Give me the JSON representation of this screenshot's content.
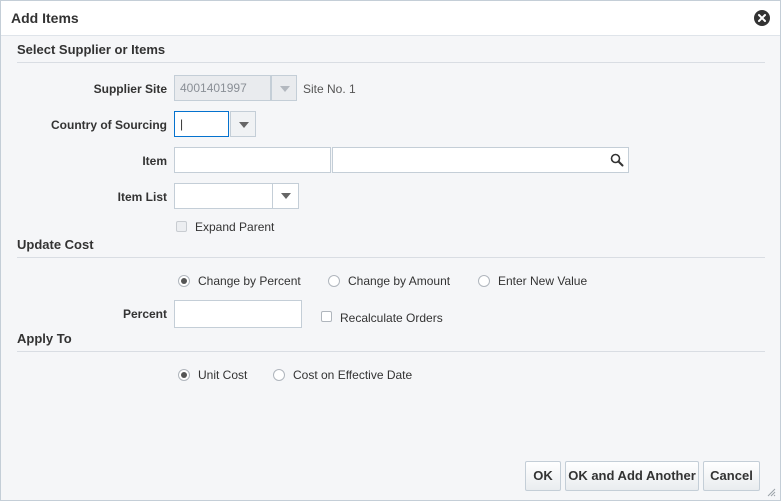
{
  "dialog": {
    "title": "Add Items",
    "close_icon": "close-circle-icon"
  },
  "select_section": {
    "header": "Select Supplier or Items",
    "supplier_site": {
      "label": "Supplier Site",
      "value": "4001401997",
      "site_text": "Site No. 1",
      "disabled": true
    },
    "country_of_sourcing": {
      "label": "Country of Sourcing",
      "value": "|"
    },
    "item": {
      "label": "Item",
      "value": "",
      "description": "",
      "search_icon": "search-icon"
    },
    "item_list": {
      "label": "Item List",
      "value": ""
    },
    "expand_parent": {
      "label": "Expand Parent",
      "checked": false,
      "disabled": true
    }
  },
  "update_cost_section": {
    "header": "Update Cost",
    "options": [
      {
        "label": "Change by Percent",
        "selected": true
      },
      {
        "label": "Change by Amount",
        "selected": false
      },
      {
        "label": "Enter New Value",
        "selected": false
      }
    ],
    "percent": {
      "label": "Percent",
      "value": ""
    },
    "recalculate_orders": {
      "label": "Recalculate Orders",
      "checked": false
    }
  },
  "apply_to_section": {
    "header": "Apply To",
    "options": [
      {
        "label": "Unit Cost",
        "selected": true
      },
      {
        "label": "Cost on Effective Date",
        "selected": false
      }
    ]
  },
  "footer": {
    "ok_label": "OK",
    "ok_add_another_label": "OK and Add Another",
    "cancel_label": "Cancel"
  }
}
